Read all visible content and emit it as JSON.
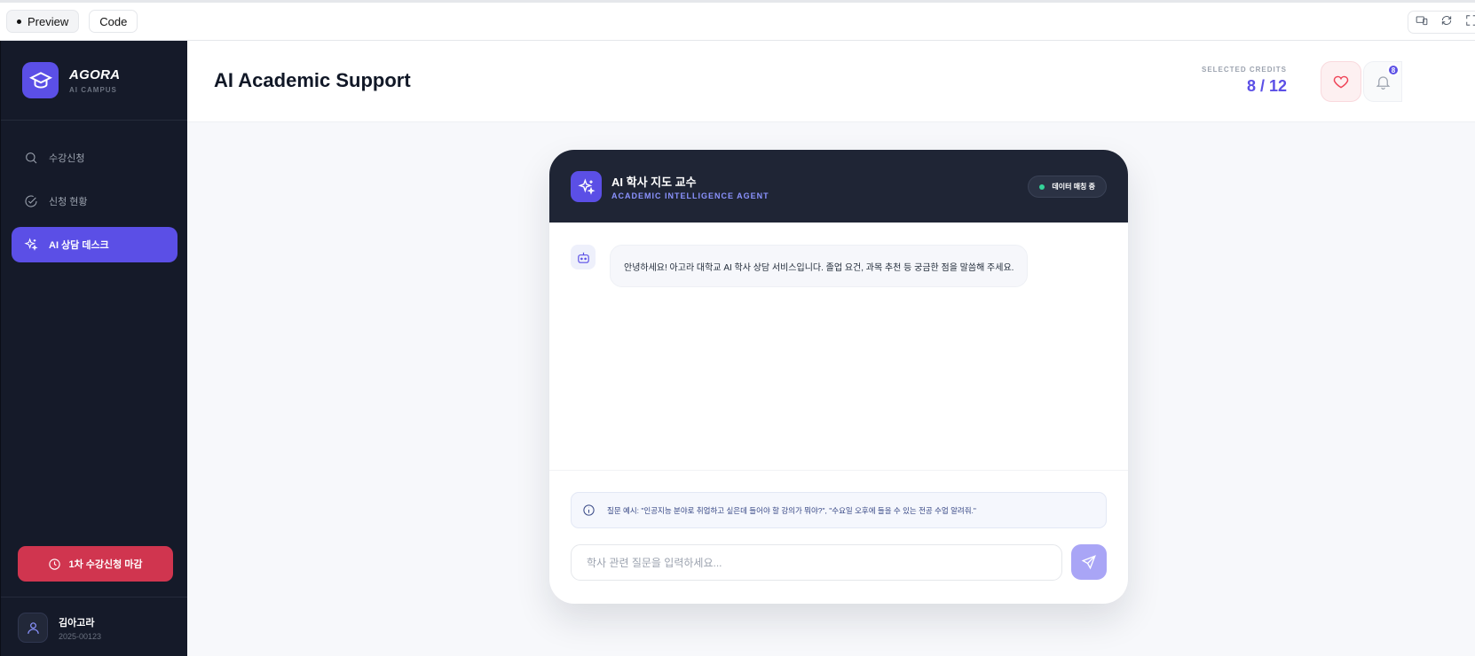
{
  "toolbar": {
    "preview_label": "Preview",
    "code_label": "Code",
    "icons": [
      "responsive-icon",
      "refresh-icon",
      "fullscreen-icon"
    ]
  },
  "sidebar": {
    "brand_name": "AGORA",
    "brand_sub": "AI CAMPUS",
    "items": [
      {
        "label": "수강신청",
        "icon": "search-icon",
        "active": false
      },
      {
        "label": "신청 현황",
        "icon": "check-circle-icon",
        "active": false
      },
      {
        "label": "AI 상담 데스크",
        "icon": "sparkles-icon",
        "active": true
      }
    ],
    "deadline_label": "1차 수강신청 마감",
    "user": {
      "name": "김아고라",
      "id": "2025-00123"
    }
  },
  "header": {
    "title": "AI Academic Support",
    "credits_label": "SELECTED CREDITS",
    "credits_value": "8 / 12",
    "notification_count": "8"
  },
  "chat": {
    "agent_name": "AI 학사 지도 교수",
    "agent_sub": "ACADEMIC INTELLIGENCE AGENT",
    "status": "데이터 매칭 중",
    "messages": [
      {
        "sender": "bot",
        "text": "안녕하세요! 아고라 대학교 AI 학사 상담 서비스입니다. 졸업 요건, 과목 추천 등 궁금한 점을 말씀해 주세요."
      }
    ],
    "hint": "질문 예시: \"인공지능 분야로 취업하고 싶은데 들어야 할 강의가 뭐야?\", \"수요일 오후에 들을 수 있는 전공 수업 알려줘.\"",
    "input_value": "",
    "input_placeholder": "학사 관련 질문을 입력하세요..."
  },
  "colors": {
    "accent": "#5b4fe6",
    "sidebar_bg": "#151a29",
    "danger": "#d0354f",
    "chat_header_bg": "#1f2535",
    "status_dot": "#34d399"
  }
}
